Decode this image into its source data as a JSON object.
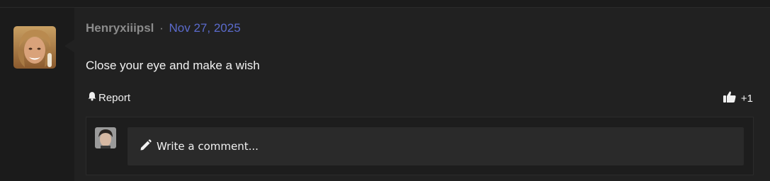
{
  "post": {
    "username": "Henryxiiipsl",
    "separator": "·",
    "date": "Nov 27, 2025",
    "text": "Close your eye and make a wish"
  },
  "actions": {
    "report_label": "Report",
    "like_count": "+1"
  },
  "comment": {
    "placeholder": "Write a comment..."
  },
  "icons": {
    "report": "bell-icon",
    "like": "thumbs-up-icon",
    "comment": "pencil-icon"
  },
  "colors": {
    "background": "#1b1b1b",
    "panel": "#212121",
    "username": "#8b8b8b",
    "date": "#5b6bcc",
    "input": "#2a2a2a"
  }
}
